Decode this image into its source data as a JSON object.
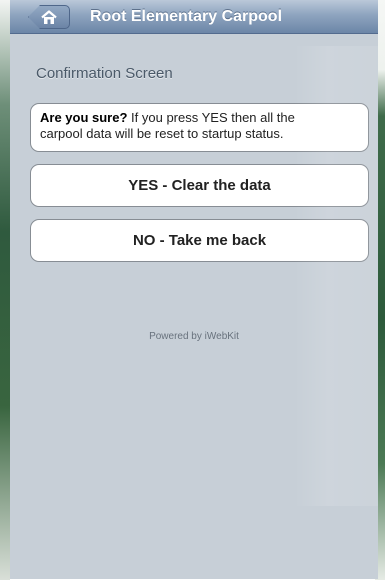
{
  "header": {
    "title": "Root Elementary Carpool"
  },
  "page": {
    "section_title": "Confirmation Screen",
    "message": {
      "strong": "Are you sure?",
      "line1_rest": " If you press YES then all the",
      "line2": "carpool data will be reset to startup status."
    },
    "buttons": {
      "yes_label": "YES - Clear the data",
      "no_label": "NO - Take me back"
    },
    "footer": "Powered by iWebKit"
  },
  "icons": {
    "home": "home-icon"
  },
  "colors": {
    "header_top": "#bac8d9",
    "header_bottom": "#6c86a7",
    "page_background": "#c7cfd7",
    "button_background": "#ffffff",
    "button_border": "#878d94"
  }
}
